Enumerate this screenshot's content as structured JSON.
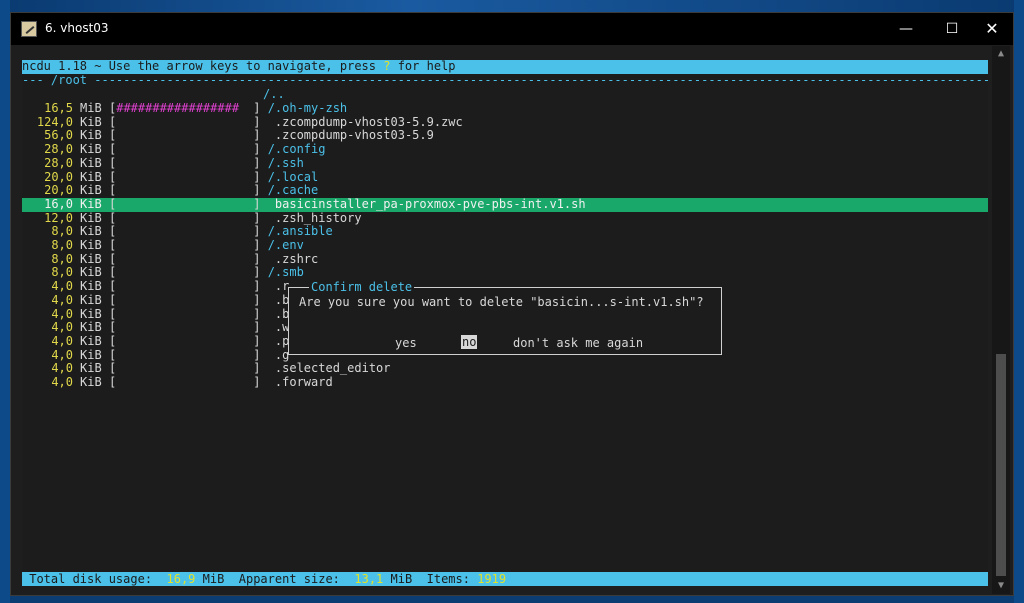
{
  "window": {
    "title": "6. vhost03",
    "minimize_glyph": "—",
    "maximize_glyph": "☐",
    "close_glyph": "✕"
  },
  "terminal": {
    "top_bar_prefix": "ncdu 1.18 ~ Use the arrow keys to navigate, press ",
    "top_bar_key": "?",
    "top_bar_suffix": " for help",
    "path_header": "--- /root -------------------------------------------------------------------------------------------------------------------------------",
    "parent_entry": "/..",
    "rows": [
      {
        "size": "16,5",
        "unit": "MiB",
        "graph": "#################",
        "name": "/.oh-my-zsh",
        "is_dir": true
      },
      {
        "size": "124,0",
        "unit": "KiB",
        "graph": "",
        "name": " .zcompdump-vhost03-5.9.zwc",
        "is_dir": false
      },
      {
        "size": "56,0",
        "unit": "KiB",
        "graph": "",
        "name": " .zcompdump-vhost03-5.9",
        "is_dir": false
      },
      {
        "size": "28,0",
        "unit": "KiB",
        "graph": "",
        "name": "/.config",
        "is_dir": true
      },
      {
        "size": "28,0",
        "unit": "KiB",
        "graph": "",
        "name": "/.ssh",
        "is_dir": true
      },
      {
        "size": "20,0",
        "unit": "KiB",
        "graph": "",
        "name": "/.local",
        "is_dir": true
      },
      {
        "size": "20,0",
        "unit": "KiB",
        "graph": "",
        "name": "/.cache",
        "is_dir": true
      },
      {
        "size": "16,0",
        "unit": "KiB",
        "graph": "",
        "name": " basicinstaller_pa-proxmox-pve-pbs-int.v1.sh",
        "is_dir": false,
        "selected": true
      },
      {
        "size": "12,0",
        "unit": "KiB",
        "graph": "",
        "name": " .zsh_history",
        "is_dir": false
      },
      {
        "size": "8,0",
        "unit": "KiB",
        "graph": "",
        "name": "/.ansible",
        "is_dir": true
      },
      {
        "size": "8,0",
        "unit": "KiB",
        "graph": "",
        "name": "/.env",
        "is_dir": true
      },
      {
        "size": "8,0",
        "unit": "KiB",
        "graph": "",
        "name": " .zshrc",
        "is_dir": false
      },
      {
        "size": "8,0",
        "unit": "KiB",
        "graph": "",
        "name": "/.smb",
        "is_dir": true
      },
      {
        "size": "4,0",
        "unit": "KiB",
        "graph": "",
        "name": " .r",
        "is_dir": false
      },
      {
        "size": "4,0",
        "unit": "KiB",
        "graph": "",
        "name": " .b",
        "is_dir": false
      },
      {
        "size": "4,0",
        "unit": "KiB",
        "graph": "",
        "name": " .b",
        "is_dir": false
      },
      {
        "size": "4,0",
        "unit": "KiB",
        "graph": "",
        "name": " .w",
        "is_dir": false
      },
      {
        "size": "4,0",
        "unit": "KiB",
        "graph": "",
        "name": " .p",
        "is_dir": false
      },
      {
        "size": "4,0",
        "unit": "KiB",
        "graph": "",
        "name": " .g",
        "is_dir": false
      },
      {
        "size": "4,0",
        "unit": "KiB",
        "graph": "",
        "name": " .selected_editor",
        "is_dir": false
      },
      {
        "size": "4,0",
        "unit": "KiB",
        "graph": "",
        "name": " .forward",
        "is_dir": false
      }
    ],
    "dialog": {
      "title": "Confirm delete",
      "question": "Are you sure you want to delete \"basicin...s-int.v1.sh\"?",
      "yes": "yes",
      "no": "no",
      "dont_ask": "don't ask me again"
    },
    "bottom_bar": {
      "total_label": " Total disk usage: ",
      "total_value": " 16,9",
      "total_unit": " MiB",
      "apparent_label": "  Apparent size: ",
      "apparent_value": " 13,1",
      "apparent_unit": " MiB",
      "items_label": "  Items: ",
      "items_value": "1919"
    }
  },
  "colors": {
    "accent_cyan": "#4bc0e8",
    "selection_green": "#1aa86a",
    "graph_magenta": "#e040d0",
    "size_yellow": "#e0d84a"
  }
}
